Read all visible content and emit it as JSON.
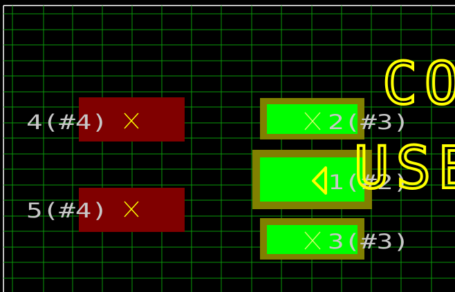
{
  "canvas": {
    "background": "#000000",
    "grid_color": "#0a9a0a",
    "border_color": "#ffffff"
  },
  "colors": {
    "pad_fill": "#00ff00",
    "pad_outline": "#808000",
    "pad_disabled": "#800000",
    "label_text": "#c8c8c8",
    "marker": "#ffff00",
    "silkscreen_text": "#ffff00"
  },
  "silkscreen": {
    "text_line_1": "CO",
    "text_line_2": "USE"
  },
  "pads": [
    {
      "id": "pad-4",
      "label": "4(#4)",
      "state": "inactive"
    },
    {
      "id": "pad-5",
      "label": "5(#4)",
      "state": "inactive"
    },
    {
      "id": "pad-2",
      "label": "2(#3)",
      "state": "active"
    },
    {
      "id": "pad-1",
      "label": "1(#2)",
      "state": "active"
    },
    {
      "id": "pad-3",
      "label": "3(#3)",
      "state": "active"
    }
  ],
  "icons": {
    "pad_marker": "x-cross-icon",
    "pin1_indicator": "triangle-left-icon"
  }
}
